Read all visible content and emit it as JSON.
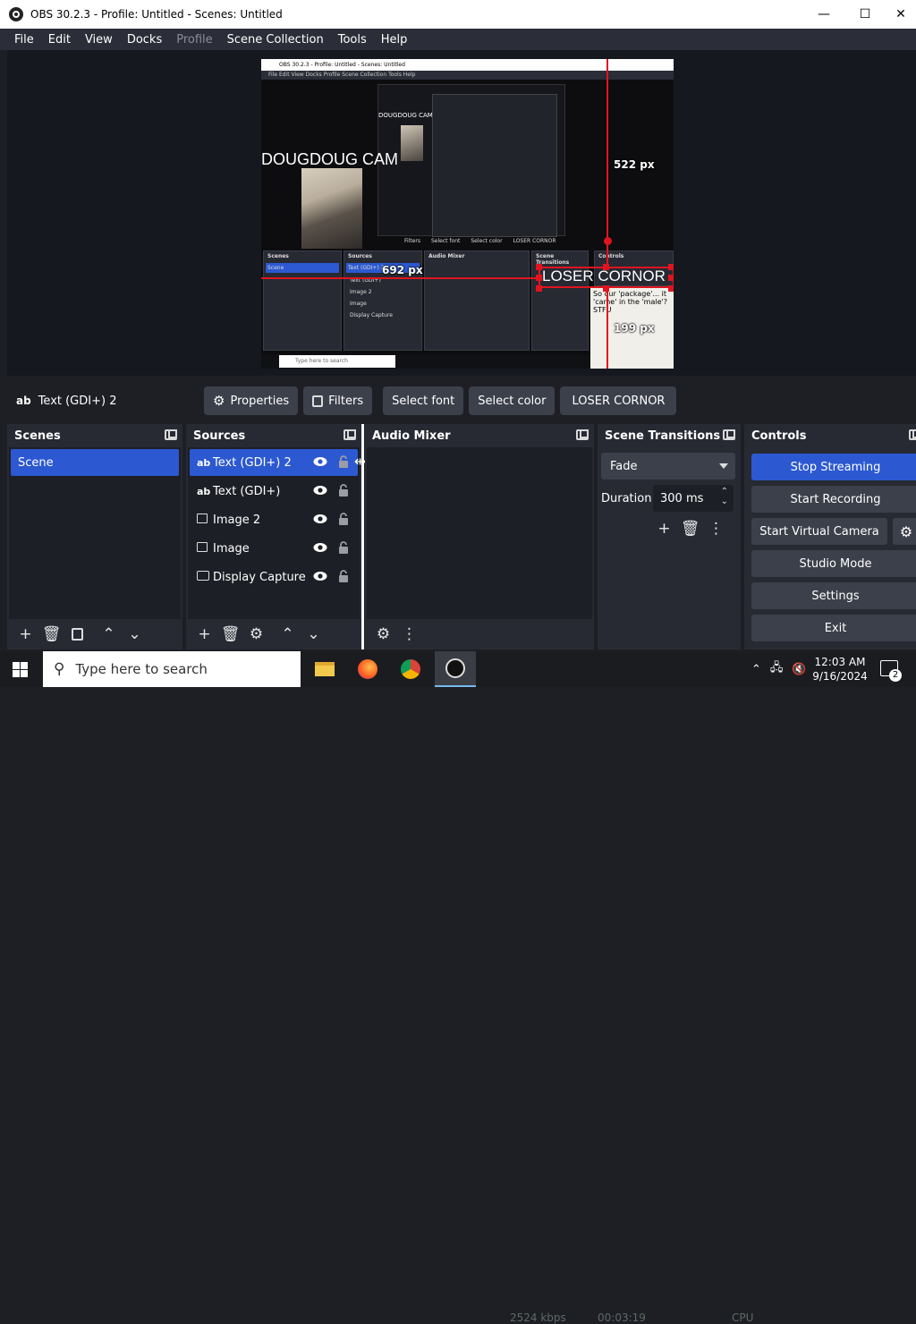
{
  "window": {
    "title": "OBS 30.2.3 - Profile: Untitled - Scenes: Untitled",
    "minimize_glyph": "—",
    "maximize_glyph": "☐",
    "close_glyph": "✕"
  },
  "menu": [
    "File",
    "Edit",
    "View",
    "Docks",
    "Profile",
    "Scene Collection",
    "Tools",
    "Help"
  ],
  "preview": {
    "nested_title": "OBS 30.2.3 - Profile: Untitled - Scenes: Untitled",
    "nested_menu": "File   Edit   View   Docks   Profile   Scene Collection   Tools   Help",
    "cam_label": "DOUGDOUG CAM",
    "loser_label": "LOSER CORNOR",
    "guide_labels": {
      "top": "522 px",
      "left": "692 px",
      "bottom": "199 px"
    },
    "meme_text": "So our 'package'... it 'came' in the 'male'? STFU",
    "nested_search": "Type here to search",
    "nested_ctx": [
      "Filters",
      "Select font",
      "Select color",
      "LOSER CORNOR"
    ],
    "nested_docks": [
      "Scenes",
      "Sources",
      "Audio Mixer",
      "Scene Transitions",
      "Controls"
    ],
    "nested_sources": [
      "Text (GDI+) 2",
      "Text (GDI+)",
      "Image 2",
      "Image",
      "Display Capture"
    ],
    "nested_scene": "Scene"
  },
  "context_bar": {
    "source_icon": "ab",
    "source_name": "Text (GDI+) 2",
    "properties": "Properties",
    "filters": "Filters",
    "select_font": "Select font",
    "select_color": "Select color",
    "text_value": "LOSER CORNOR"
  },
  "scenes": {
    "title": "Scenes",
    "items": [
      "Scene"
    ]
  },
  "sources": {
    "title": "Sources",
    "items": [
      {
        "icon": "ab",
        "label": "Text (GDI+) 2"
      },
      {
        "icon": "ab",
        "label": "Text (GDI+)"
      },
      {
        "icon": "image",
        "label": "Image 2"
      },
      {
        "icon": "image",
        "label": "Image"
      },
      {
        "icon": "display",
        "label": "Display Capture"
      }
    ]
  },
  "audio_mixer": {
    "title": "Audio Mixer"
  },
  "transitions": {
    "title": "Scene Transitions",
    "selected": "Fade",
    "duration_label": "Duration",
    "duration_value": "300 ms"
  },
  "controls": {
    "title": "Controls",
    "stop_streaming": "Stop Streaming",
    "start_recording": "Start Recording",
    "start_virtual_camera": "Start Virtual Camera",
    "studio_mode": "Studio Mode",
    "settings": "Settings",
    "exit": "Exit"
  },
  "taskbar": {
    "search_placeholder": "Type here to search",
    "ghost_status": [
      "2524 kbps",
      "00:03:19",
      "CPU"
    ],
    "time": "12:03 AM",
    "date": "9/16/2024",
    "notification_count": "2"
  },
  "colors": {
    "accent": "#2c59d1",
    "guide": "#e0141e",
    "dock_bg": "#272a33",
    "button_bg": "#3c404b"
  }
}
